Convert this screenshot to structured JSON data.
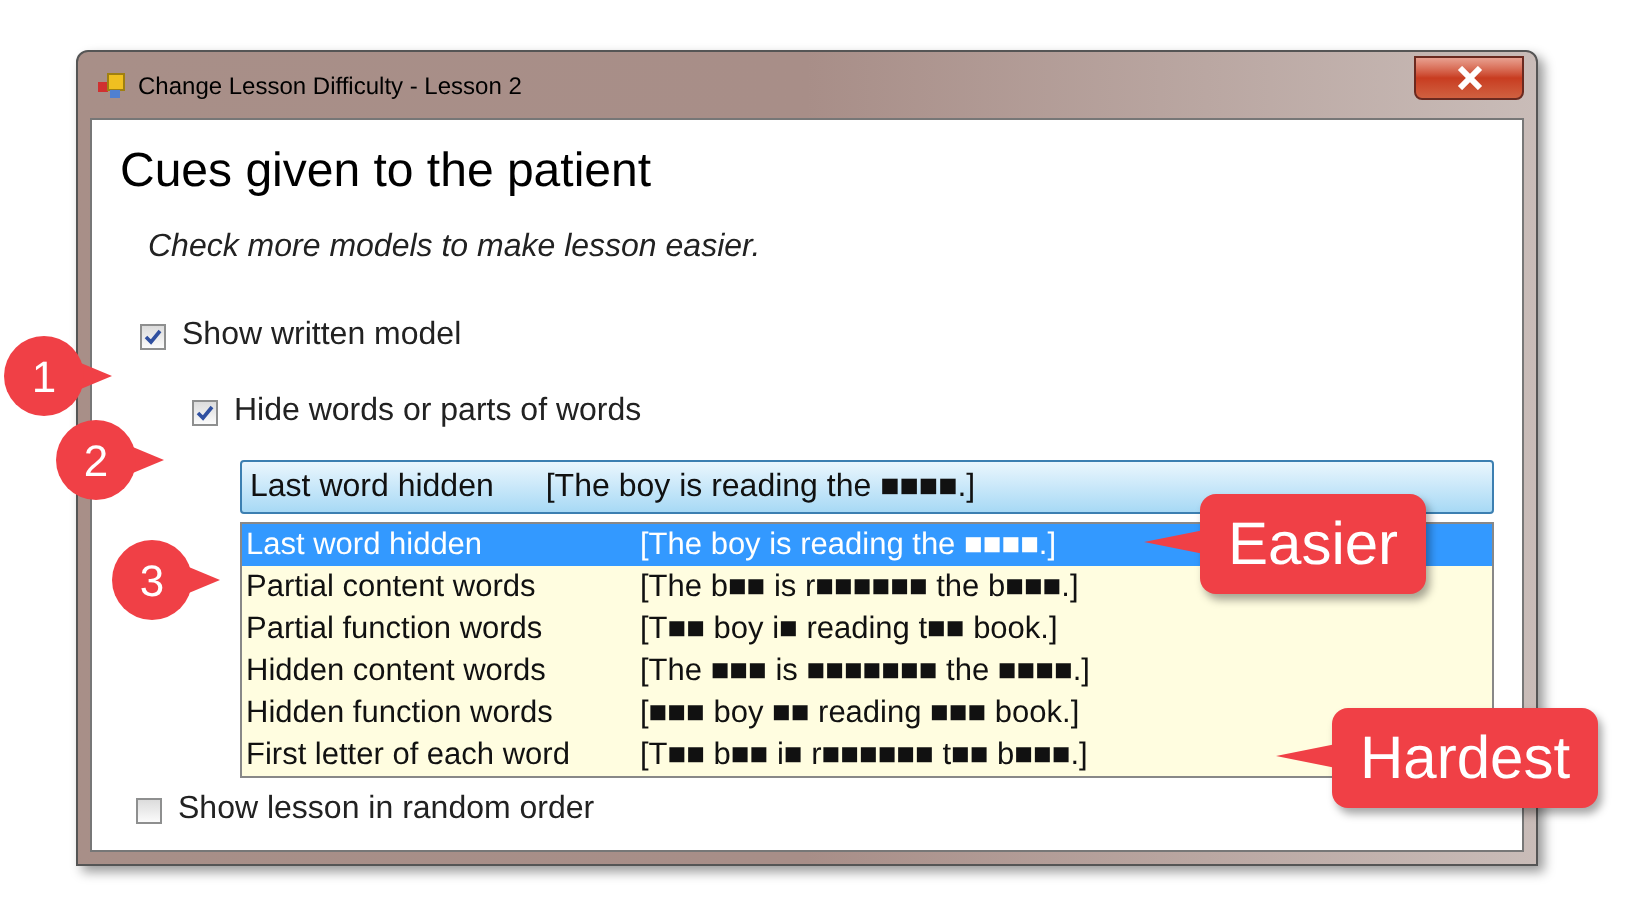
{
  "window": {
    "title": "Change Lesson Difficulty - Lesson 2"
  },
  "heading": "Cues given to the patient",
  "instruction": "Check more models to make lesson easier.",
  "checkboxes": [
    {
      "label": "Show written model",
      "checked": true,
      "indent": false
    },
    {
      "label": "Hide words or parts of words",
      "checked": true,
      "indent": true
    }
  ],
  "dropdown": {
    "value_label": "Last word hidden",
    "value_example": "[The boy is reading the ■■■■.]",
    "expanded": true,
    "options": [
      {
        "label": "Last word hidden",
        "example": "[The boy is reading the ■■■■.]",
        "selected": true
      },
      {
        "label": "Partial content words",
        "example": "[The b■■ is r■■■■■■ the b■■■.]",
        "selected": false
      },
      {
        "label": "Partial function words",
        "example": "[T■■ boy i■ reading t■■ book.]",
        "selected": false
      },
      {
        "label": "Hidden content words",
        "example": "[The ■■■ is ■■■■■■■ the ■■■■.]",
        "selected": false
      },
      {
        "label": "Hidden function words",
        "example": "[■■■ boy ■■ reading ■■■ book.]",
        "selected": false
      },
      {
        "label": "First letter of each word",
        "example": "[T■■ b■■ i■ r■■■■■■ t■■ b■■■.]",
        "selected": false
      }
    ]
  },
  "random_order": {
    "label": "Show lesson in random order",
    "checked": false
  },
  "callouts": [
    {
      "kind": "number",
      "text": "1"
    },
    {
      "kind": "number",
      "text": "2"
    },
    {
      "kind": "number",
      "text": "3"
    },
    {
      "kind": "label",
      "text": "Easier"
    },
    {
      "kind": "label",
      "text": "Hardest"
    }
  ]
}
